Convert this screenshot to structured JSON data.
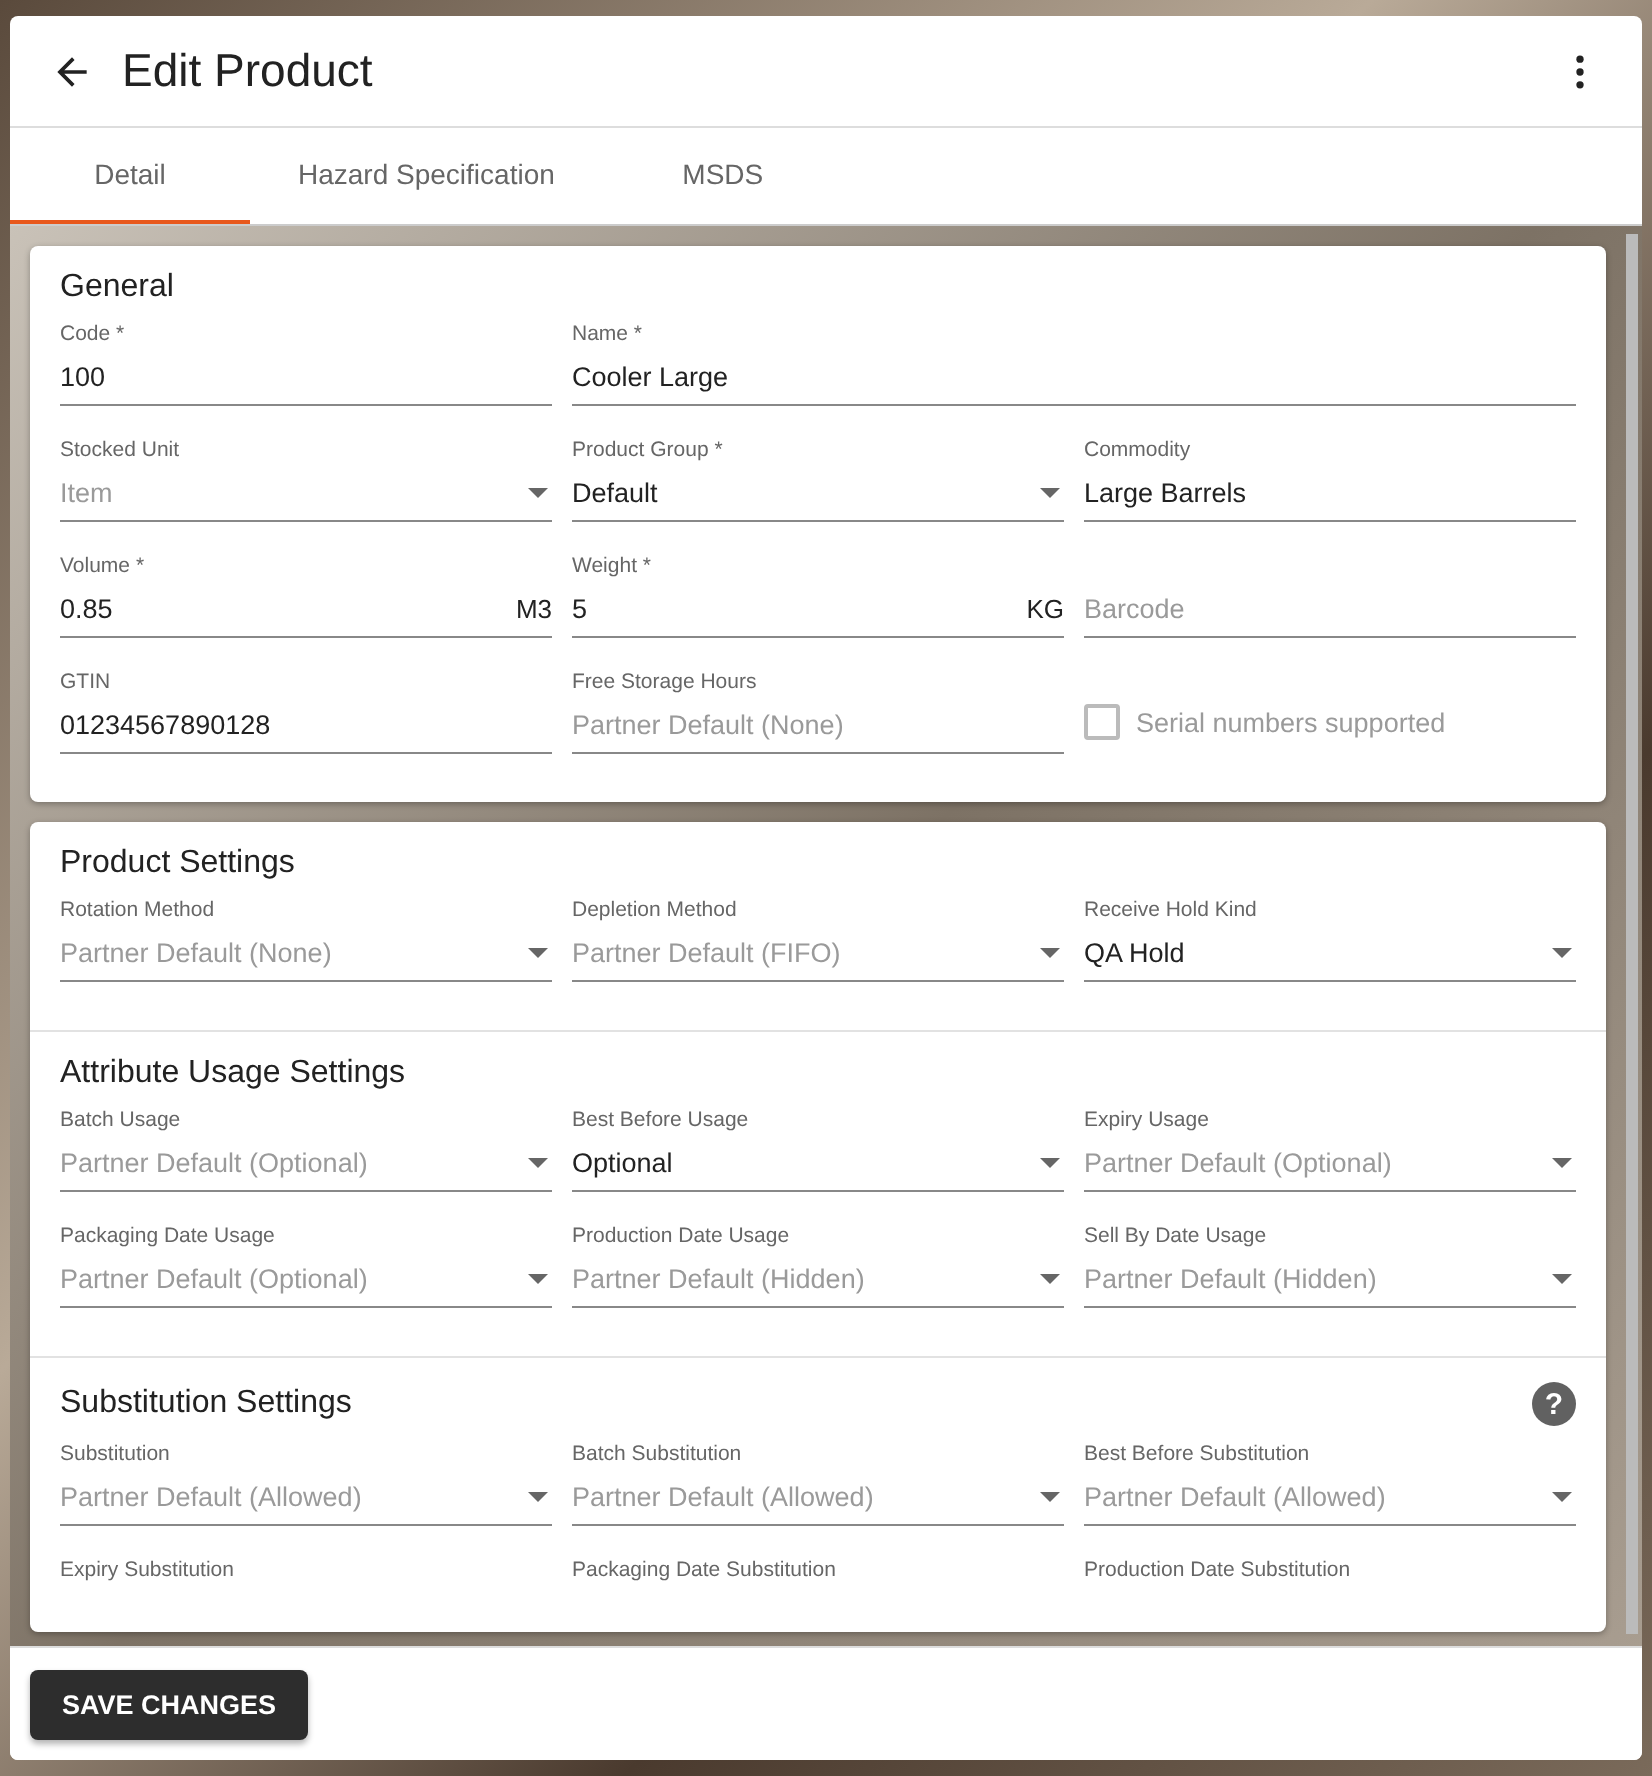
{
  "window": {
    "title": "Edit Product"
  },
  "tabs": [
    {
      "label": "Detail",
      "selected": true
    },
    {
      "label": "Hazard Specification",
      "selected": false
    },
    {
      "label": "MSDS",
      "selected": false
    }
  ],
  "cards": [
    {
      "sections": [
        {
          "title": "General",
          "rows": [
            [
              {
                "kind": "text",
                "label": "Code *",
                "value": "100"
              },
              {
                "kind": "text",
                "label": "Name *",
                "value": "Cooler Large",
                "wide": true
              }
            ],
            [
              {
                "kind": "select",
                "label": "Stocked Unit",
                "value": "Item",
                "muted": true
              },
              {
                "kind": "select",
                "label": "Product Group *",
                "value": "Default"
              },
              {
                "kind": "text",
                "label": "Commodity",
                "value": "Large Barrels"
              }
            ],
            [
              {
                "kind": "text",
                "label": "Volume *",
                "value": "0.85",
                "suffix": "M3"
              },
              {
                "kind": "text",
                "label": "Weight *",
                "value": "5",
                "suffix": "KG"
              },
              {
                "kind": "text",
                "placeholder": "Barcode"
              }
            ],
            [
              {
                "kind": "text",
                "label": "GTIN",
                "value": "01234567890128"
              },
              {
                "kind": "text",
                "label": "Free Storage Hours",
                "value": "Partner Default (None)",
                "muted": true
              },
              {
                "kind": "checkbox",
                "label": "Serial numbers supported",
                "checked": false
              }
            ]
          ]
        }
      ]
    },
    {
      "sections": [
        {
          "title": "Product Settings",
          "rows": [
            [
              {
                "kind": "select",
                "label": "Rotation Method",
                "value": "Partner Default (None)",
                "muted": true
              },
              {
                "kind": "select",
                "label": "Depletion Method",
                "value": "Partner Default (FIFO)",
                "muted": true
              },
              {
                "kind": "select",
                "label": "Receive Hold Kind",
                "value": "QA Hold"
              }
            ]
          ]
        },
        {
          "title": "Attribute Usage Settings",
          "rows": [
            [
              {
                "kind": "select",
                "label": "Batch Usage",
                "value": "Partner Default (Optional)",
                "muted": true
              },
              {
                "kind": "select",
                "label": "Best Before Usage",
                "value": "Optional"
              },
              {
                "kind": "select",
                "label": "Expiry Usage",
                "value": "Partner Default (Optional)",
                "muted": true
              }
            ],
            [
              {
                "kind": "select",
                "label": "Packaging Date Usage",
                "value": "Partner Default (Optional)",
                "muted": true
              },
              {
                "kind": "select",
                "label": "Production Date Usage",
                "value": "Partner Default (Hidden)",
                "muted": true
              },
              {
                "kind": "select",
                "label": "Sell By Date Usage",
                "value": "Partner Default (Hidden)",
                "muted": true
              }
            ]
          ]
        },
        {
          "title": "Substitution Settings",
          "help": "?",
          "rows": [
            [
              {
                "kind": "select",
                "label": "Substitution",
                "value": "Partner Default (Allowed)",
                "muted": true
              },
              {
                "kind": "select",
                "label": "Batch Substitution",
                "value": "Partner Default (Allowed)",
                "muted": true
              },
              {
                "kind": "select",
                "label": "Best Before Substitution",
                "value": "Partner Default (Allowed)",
                "muted": true
              }
            ],
            [
              {
                "kind": "label",
                "label": "Expiry Substitution"
              },
              {
                "kind": "label",
                "label": "Packaging Date Substitution"
              },
              {
                "kind": "label",
                "label": "Production Date Substitution"
              }
            ]
          ]
        }
      ]
    }
  ],
  "footer": {
    "button": "SAVE CHANGES"
  }
}
